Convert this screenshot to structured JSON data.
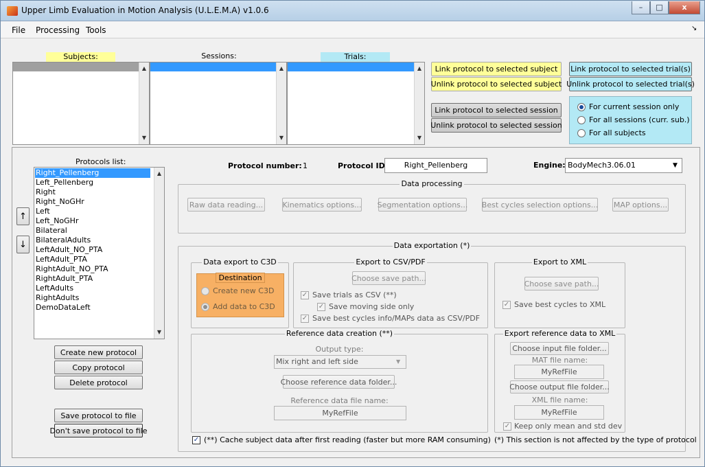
{
  "window": {
    "title": "Upper Limb Evaluation in Motion Analysis (U.L.E.M.A) v1.0.6",
    "controls": {
      "minimize": "–",
      "maximize": "□",
      "close": "x"
    }
  },
  "menu": {
    "items": [
      "File",
      "Processing",
      "Tools"
    ],
    "corner": "↘"
  },
  "top": {
    "subjects_header": "Subjects:",
    "sessions_header": "Sessions:",
    "trials_header": "Trials:",
    "link_subject": "Link protocol to selected subject",
    "unlink_subject": "Unlink protocol to selected subject",
    "link_session": "Link protocol to selected session",
    "unlink_session": "Unlink protocol to selected session",
    "link_trials": "Link protocol to selected trial(s)",
    "unlink_trials": "Unlink protocol to selected trial(s)",
    "scope_options": [
      "For current session only",
      "For all sessions (curr. sub.)",
      "For all subjects"
    ],
    "scope_selected": 0,
    "colors": {
      "subjects_header": "#ffff99",
      "trials_header": "#b3e9f5",
      "scope_panel": "#b3e9f5",
      "yellow_button": "#ffff99"
    }
  },
  "protocols": {
    "label": "Protocols list:",
    "items": [
      "Right_Pellenberg",
      "Left_Pellenberg",
      "Right",
      "Right_NoGHr",
      "Left",
      "Left_NoGHr",
      "Bilateral",
      "BilateralAdults",
      "LeftAdult_NO_PTA",
      "LeftAdult_PTA",
      "RightAdult_NO_PTA",
      "RightAdult_PTA",
      "LeftAdults",
      "RightAdults",
      "DemoDataLeft"
    ],
    "selected": 0,
    "move_up": "↑",
    "move_down": "↓",
    "create": "Create new protocol",
    "copy": "Copy protocol",
    "delete": "Delete protocol",
    "save": "Save protocol to file",
    "dont_save": "Don't save protocol to file"
  },
  "info": {
    "number_label": "Protocol number:",
    "number_value": "1",
    "id_label": "Protocol ID:",
    "id_value": "Right_Pellenberg",
    "engine_label": "Engine:",
    "engine_value": "BodyMech3.06.01"
  },
  "processing": {
    "title": "Data processing",
    "buttons": [
      "Raw data reading...",
      "Kinematics options...",
      "Segmentation options...",
      "Best cycles selection options...",
      "MAP options..."
    ]
  },
  "exportation": {
    "title": "Data exportation (*)",
    "c3d": {
      "title": "Data export to C3D",
      "destination": "Destination",
      "create": "Create new C3D",
      "add": "Add data to C3D",
      "selected": 1,
      "color": "#f7b064"
    },
    "csv": {
      "title": "Export to CSV/PDF",
      "choose": "Choose save path...",
      "save_trials": "Save trials as CSV (**)",
      "save_moving": "Save moving side only",
      "save_best": "Save best cycles info/MAPs data as CSV/PDF"
    },
    "xml": {
      "title": "Export to XML",
      "choose": "Choose save path...",
      "save_best": "Save best cycles to XML"
    },
    "ref": {
      "title": "Reference data creation (**)",
      "output_type_label": "Output type:",
      "output_type_value": "Mix right and left side",
      "choose_folder": "Choose reference data folder...",
      "file_name_label": "Reference data file name:",
      "file_name_value": "MyRefFile"
    },
    "ref_xml": {
      "title": "Export reference data to XML",
      "choose_input": "Choose input file folder...",
      "mat_label": "MAT file name:",
      "mat_value": "MyRefFile",
      "choose_output": "Choose output file folder...",
      "xml_label": "XML file name:",
      "xml_value": "MyRefFile",
      "keep_mean": "Keep only mean and std dev"
    },
    "cache": "(**) Cache subject data after first reading (faster but more RAM consuming)",
    "note": "(*) This section is not affected by the type of protocol"
  }
}
